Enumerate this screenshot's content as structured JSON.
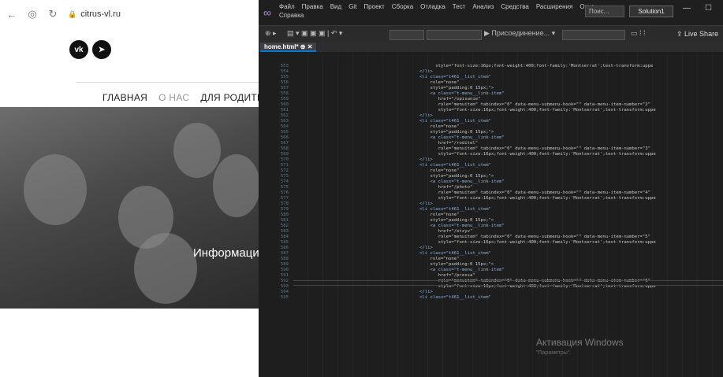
{
  "browser": {
    "url": "citrus-vl.ru",
    "logos": [
      "vk",
      "telegram"
    ],
    "nav": [
      "ГЛАВНАЯ",
      "О НАС",
      "ДЛЯ РОДИТЕ"
    ],
    "hero_title": "Информация"
  },
  "vs": {
    "menus": [
      "Файл",
      "Правка",
      "Вид",
      "Git",
      "Проект",
      "Сборка",
      "Отладка",
      "Тест",
      "Анализ",
      "Средства",
      "Расширения",
      "Окно",
      "Справка"
    ],
    "search_placeholder": "Поис...",
    "solution": "Solution1",
    "attach_label": "▶ Присоединение... ▾",
    "live_share": "Live Share",
    "tab_title": "home.html*",
    "watermark_title": "Активация Windows",
    "watermark_sub": "\"Параметры\".",
    "code": {
      "first_line": 553,
      "lines": [
        "      style=\"font-size:16px;font-weight:400;font-family:'Montserrat';text-transform:uppe",
        "</li>",
        "<li class=\"t461__list_item\"",
        "    role=\"none\"",
        "    style=\"padding:0 15px;\">",
        "    <a class=\"t-menu__link-item\"",
        "       href=\"/opisanie\"",
        "       role=\"menuitem\" tabindex=\"0\" data-menu-submenu-hook=\"\" data-menu-item-number=\"2\"",
        "       style=\"font-size:16px;font-weight:400;font-family:'Montserrat';text-transform:uppe",
        "</li>",
        "<li class=\"t461__list_item\"",
        "    role=\"none\"",
        "    style=\"padding:0 15px;\">",
        "    <a class=\"t-menu__link-item\"",
        "       href=\"/roditel\"",
        "       role=\"menuitem\" tabindex=\"0\" data-menu-submenu-hook=\"\" data-menu-item-number=\"3\"",
        "       style=\"font-size:16px;font-weight:400;font-family:'Montserrat';text-transform:uppe",
        "</li>",
        "<li class=\"t461__list_item\"",
        "    role=\"none\"",
        "    style=\"padding:0 15px;\">",
        "    <a class=\"t-menu__link-item\"",
        "       href=\"/photo\"",
        "       role=\"menuitem\" tabindex=\"0\" data-menu-submenu-hook=\"\" data-menu-item-number=\"4\"",
        "       style=\"font-size:16px;font-weight:400;font-family:'Montserrat';text-transform:uppe",
        "</li>",
        "<li class=\"t461__list_item\"",
        "    role=\"none\"",
        "    style=\"padding:0 15px;\">",
        "    <a class=\"t-menu__link-item\"",
        "       href=\"/otzyv\"",
        "       role=\"menuitem\" tabindex=\"0\" data-menu-submenu-hook=\"\" data-menu-item-number=\"5\"",
        "       style=\"font-size:16px;font-weight:400;font-family:'Montserrat';text-transform:uppe",
        "</li>",
        "<li class=\"t461__list_item\"",
        "    role=\"none\"",
        "    style=\"padding:0 15px;\">",
        "    <a class=\"t-menu__link-item\"",
        "       href=\"/pressa\"",
        "       role=\"menuitem\" tabindex=\"0\" data-menu-submenu-hook=\"\" data-menu-item-number=\"6\"",
        "       style=\"font-size:16px;font-weight:400;font-family:'Montserrat';text-transform:uppe",
        "</li>",
        "<li class=\"t461__list_item\""
      ]
    }
  }
}
